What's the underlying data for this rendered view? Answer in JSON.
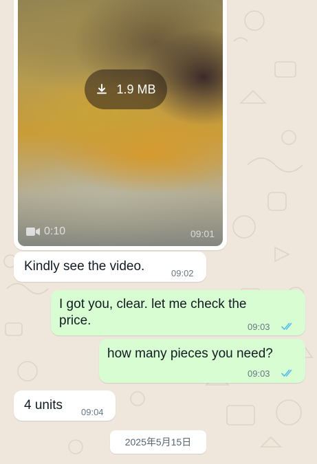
{
  "media_message": {
    "download_size": "1.9 MB",
    "video_duration": "0:10",
    "time": "09:01",
    "icons": {
      "download": "download-icon",
      "video": "video-camera-icon"
    }
  },
  "messages": [
    {
      "direction": "incoming",
      "text": "Kindly see the video.",
      "time": "09:02"
    },
    {
      "direction": "outgoing",
      "text": "I got you, clear. let me check the\nprice.",
      "time": "09:03",
      "status": "read"
    },
    {
      "direction": "outgoing",
      "text": "how many pieces you need?",
      "time": "09:03",
      "status": "read"
    },
    {
      "direction": "incoming",
      "text": "4 units",
      "time": "09:04"
    }
  ],
  "date_separator": "2025年5月15日",
  "colors": {
    "background": "#efe7dc",
    "outgoing_bubble": "#d9fdd3",
    "incoming_bubble": "#ffffff",
    "read_ticks": "#53bdeb"
  }
}
